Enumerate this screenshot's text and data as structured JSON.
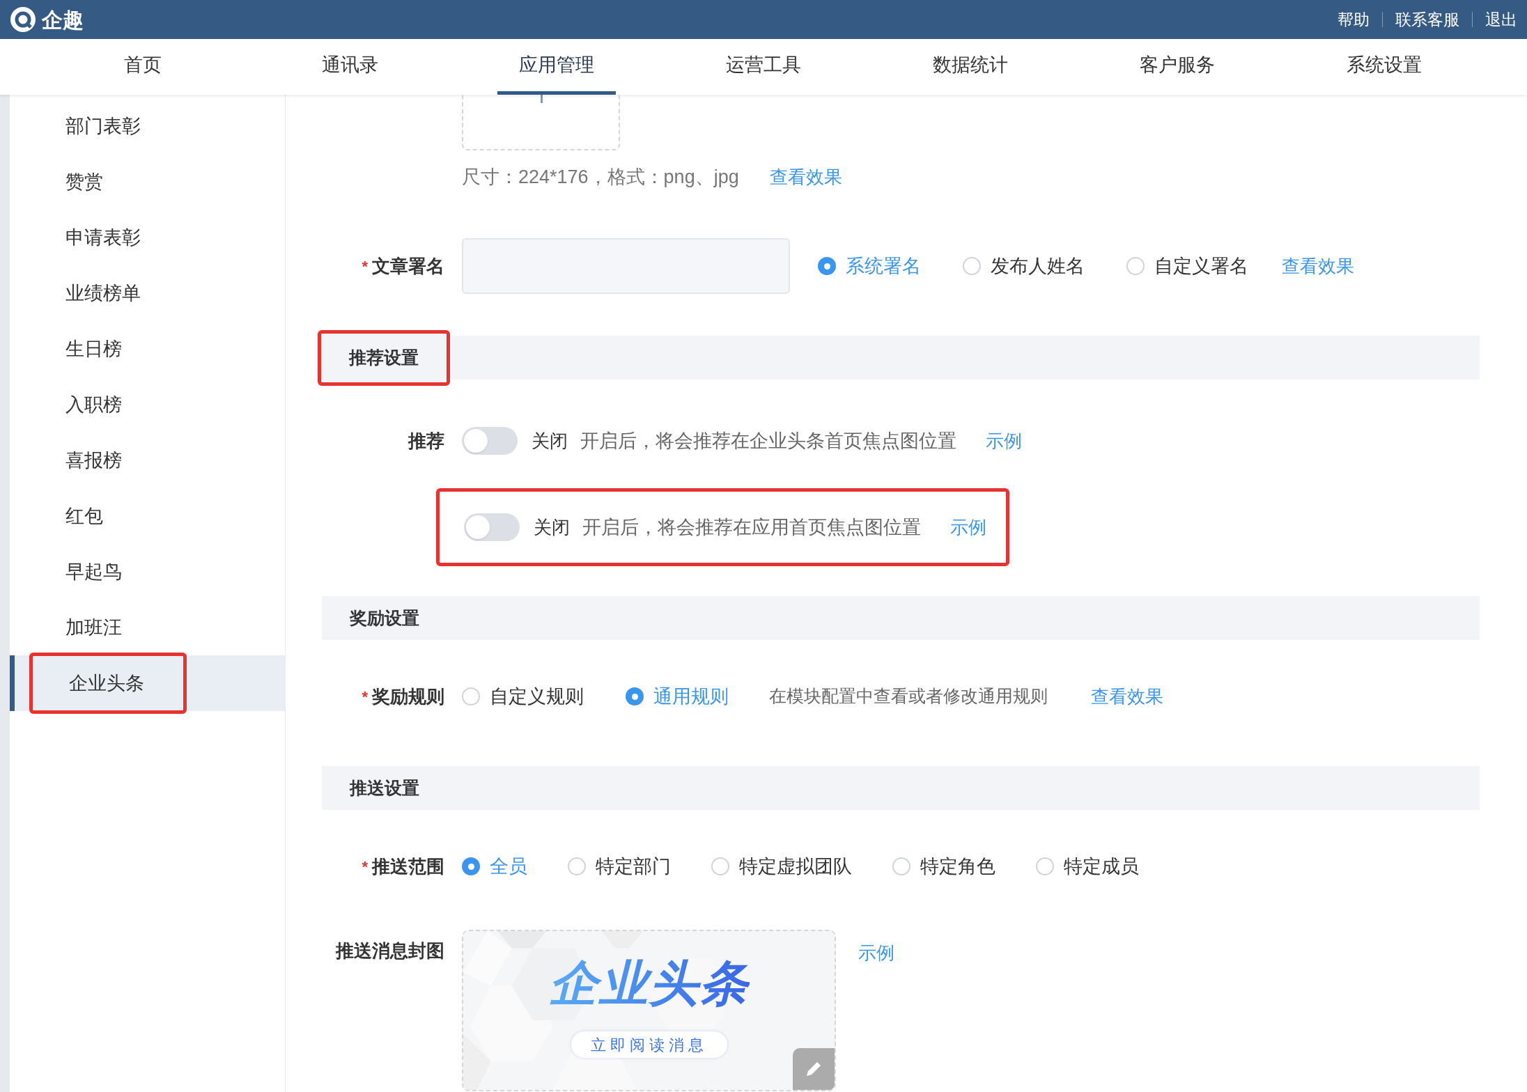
{
  "header": {
    "brand": "企趣",
    "links": [
      "帮助",
      "联系客服",
      "退出"
    ]
  },
  "nav": [
    {
      "label": "首页",
      "selected": false
    },
    {
      "label": "通讯录",
      "selected": false
    },
    {
      "label": "应用管理",
      "selected": true
    },
    {
      "label": "运营工具",
      "selected": false
    },
    {
      "label": "数据统计",
      "selected": false
    },
    {
      "label": "客户服务",
      "selected": false
    },
    {
      "label": "系统设置",
      "selected": false
    }
  ],
  "sidebar": [
    {
      "label": "部门表彰",
      "selected": false,
      "highlighted": false
    },
    {
      "label": "赞赏",
      "selected": false,
      "highlighted": false
    },
    {
      "label": "申请表彰",
      "selected": false,
      "highlighted": false
    },
    {
      "label": "业绩榜单",
      "selected": false,
      "highlighted": false
    },
    {
      "label": "生日榜",
      "selected": false,
      "highlighted": false
    },
    {
      "label": "入职榜",
      "selected": false,
      "highlighted": false
    },
    {
      "label": "喜报榜",
      "selected": false,
      "highlighted": false
    },
    {
      "label": "红包",
      "selected": false,
      "highlighted": false
    },
    {
      "label": "早起鸟",
      "selected": false,
      "highlighted": false
    },
    {
      "label": "加班汪",
      "selected": false,
      "highlighted": false
    },
    {
      "label": "企业头条",
      "selected": true,
      "highlighted": true
    }
  ],
  "upload": {
    "hint": "尺寸：224*176，格式：png、jpg",
    "link": "查看效果"
  },
  "signature": {
    "label": "文章署名",
    "required_mark": "*",
    "options": [
      {
        "label": "系统署名",
        "selected": true
      },
      {
        "label": "发布人姓名",
        "selected": false
      },
      {
        "label": "自定义署名",
        "selected": false
      }
    ],
    "link": "查看效果"
  },
  "recommend": {
    "title": "推荐设置",
    "highlighted": true,
    "rows": [
      {
        "label": "推荐",
        "on": false,
        "state_text": "关闭",
        "description": "开启后，将会推荐在企业头条首页焦点图位置",
        "link": "示例",
        "highlighted": false
      },
      {
        "on": false,
        "state_text": "关闭",
        "description": "开启后，将会推荐在应用首页焦点图位置",
        "link": "示例",
        "highlighted": true
      }
    ]
  },
  "reward": {
    "title": "奖励设置",
    "label": "奖励规则",
    "required_mark": "*",
    "options": [
      {
        "label": "自定义规则",
        "selected": false
      },
      {
        "label": "通用规则",
        "selected": true
      }
    ],
    "note": "在模块配置中查看或者修改通用规则",
    "link": "查看效果"
  },
  "push": {
    "title": "推送设置",
    "scope": {
      "label": "推送范围",
      "required_mark": "*",
      "options": [
        {
          "label": "全员",
          "selected": true
        },
        {
          "label": "特定部门",
          "selected": false
        },
        {
          "label": "特定虚拟团队",
          "selected": false
        },
        {
          "label": "特定角色",
          "selected": false
        },
        {
          "label": "特定成员",
          "selected": false
        }
      ]
    },
    "cover": {
      "label": "推送消息封图",
      "banner_title": "企业头条",
      "banner_button": "立即阅读消息",
      "link": "示例"
    }
  }
}
